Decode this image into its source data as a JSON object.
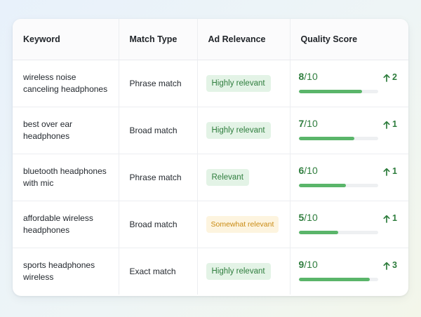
{
  "table": {
    "headers": {
      "keyword": "Keyword",
      "match_type": "Match Type",
      "ad_relevance": "Ad Relevance",
      "quality_score": "Quality Score"
    },
    "rows": [
      {
        "keyword": "wireless noise canceling headphones",
        "match_type": "Phrase match",
        "ad_relevance": "Highly relevant",
        "relevance_level": "high",
        "score": "8",
        "score_max": "/10",
        "score_fraction": 0.8,
        "change": "2"
      },
      {
        "keyword": "best over ear headphones",
        "match_type": "Broad match",
        "ad_relevance": "Highly relevant",
        "relevance_level": "high",
        "score": "7",
        "score_max": "/10",
        "score_fraction": 0.7,
        "change": "1"
      },
      {
        "keyword": "bluetooth headphones with mic",
        "match_type": "Phrase match",
        "ad_relevance": "Relevant",
        "relevance_level": "rel",
        "score": "6",
        "score_max": "/10",
        "score_fraction": 0.6,
        "change": "1"
      },
      {
        "keyword": "affordable wireless headphones",
        "match_type": "Broad match",
        "ad_relevance": "Somewhat relevant",
        "relevance_level": "some",
        "score": "5",
        "score_max": "/10",
        "score_fraction": 0.5,
        "change": "1"
      },
      {
        "keyword": "sports headphones wireless",
        "match_type": "Exact match",
        "ad_relevance": "Highly relevant",
        "relevance_level": "high",
        "score": "9",
        "score_max": "/10",
        "score_fraction": 0.9,
        "change": "3"
      }
    ]
  },
  "icons": {
    "change": "arrow-up-icon"
  },
  "colors": {
    "positive": "#2e7d3d",
    "bar_fill": "#5ab56a",
    "warning": "#c98a12"
  }
}
